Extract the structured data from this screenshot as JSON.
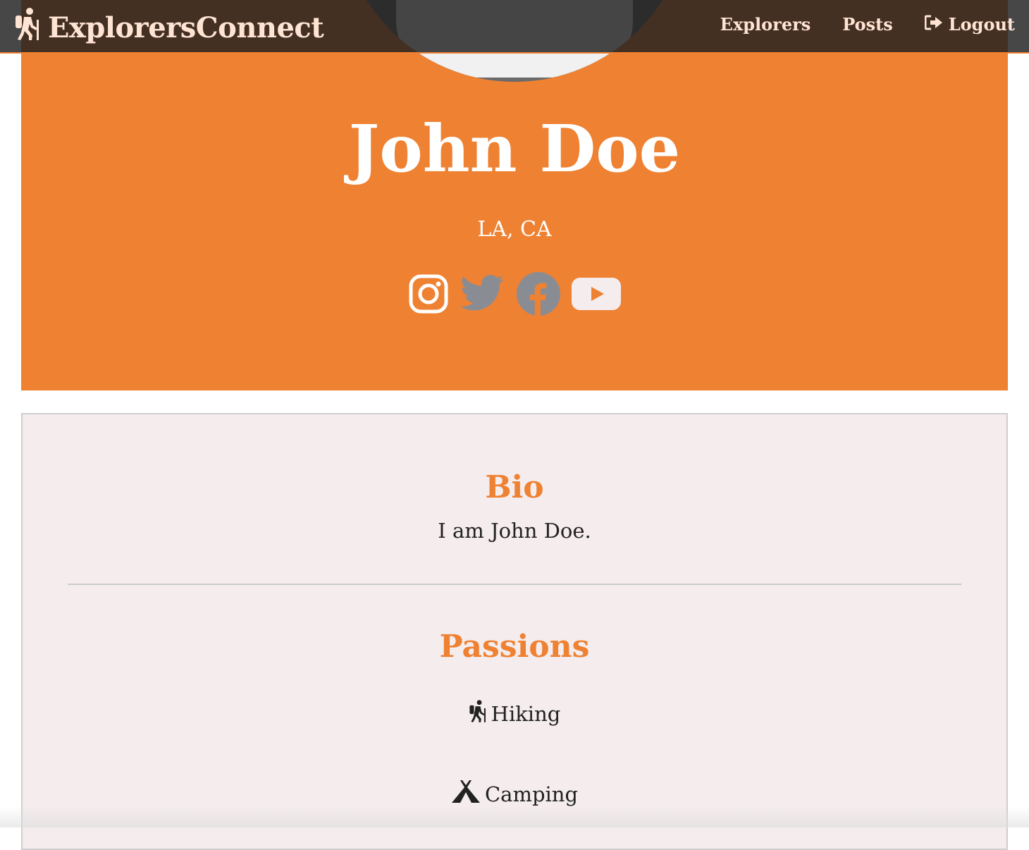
{
  "brand": {
    "name": "ExplorersConnect",
    "icon": "hiking-icon"
  },
  "nav": {
    "explorers_label": "Explorers",
    "posts_label": "Posts",
    "logout_label": "Logout"
  },
  "profile": {
    "name": "John Doe",
    "location": "LA, CA",
    "socials": [
      "instagram-icon",
      "twitter-icon",
      "facebook-icon",
      "youtube-icon"
    ]
  },
  "bio": {
    "title": "Bio",
    "text": "I am John Doe."
  },
  "passions": {
    "title": "Passions",
    "items": [
      {
        "label": "Hiking",
        "icon": "hiking-icon"
      },
      {
        "label": "Camping",
        "icon": "tent-icon"
      }
    ]
  },
  "colors": {
    "accent": "#ef8132",
    "nav_bg": "#1e1e1e",
    "card_bg": "#f4eced"
  }
}
